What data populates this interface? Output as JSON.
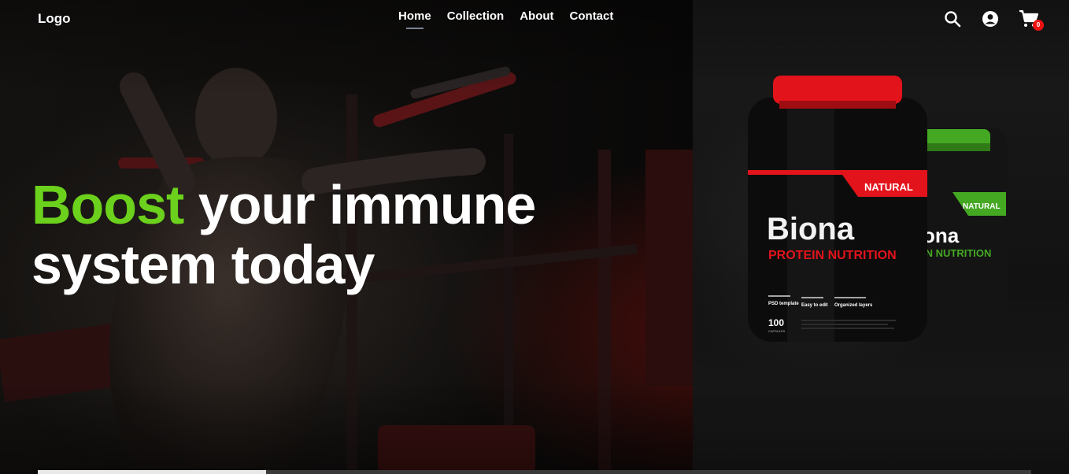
{
  "header": {
    "logo": "Logo",
    "nav": [
      {
        "label": "Home",
        "active": true
      },
      {
        "label": "Collection",
        "active": false
      },
      {
        "label": "About",
        "active": false
      },
      {
        "label": "Contact",
        "active": false
      }
    ],
    "icons": [
      "search-icon",
      "user-account-icon",
      "cart-icon"
    ],
    "cart_count": "0"
  },
  "hero": {
    "headline_accent": "Boost",
    "headline_rest": "your immune",
    "headline_line2": "system today",
    "accent_color": "#6bd11c"
  },
  "product_front": {
    "badge": "NATURAL",
    "brand": "Biona",
    "subtitle": "PROTEIN NUTRITION",
    "features": [
      "PSD template",
      "Easy to edit",
      "Organized layers"
    ],
    "count": "100",
    "count_unit": "CAPSULES",
    "lid_color": "#e3131b"
  },
  "product_back": {
    "badge": "NATURAL",
    "brand_partial": "ona",
    "subtitle_partial": "IN NUTRITION",
    "lid_color": "#45a823"
  },
  "slider": {
    "progress_fraction": 0.23
  }
}
